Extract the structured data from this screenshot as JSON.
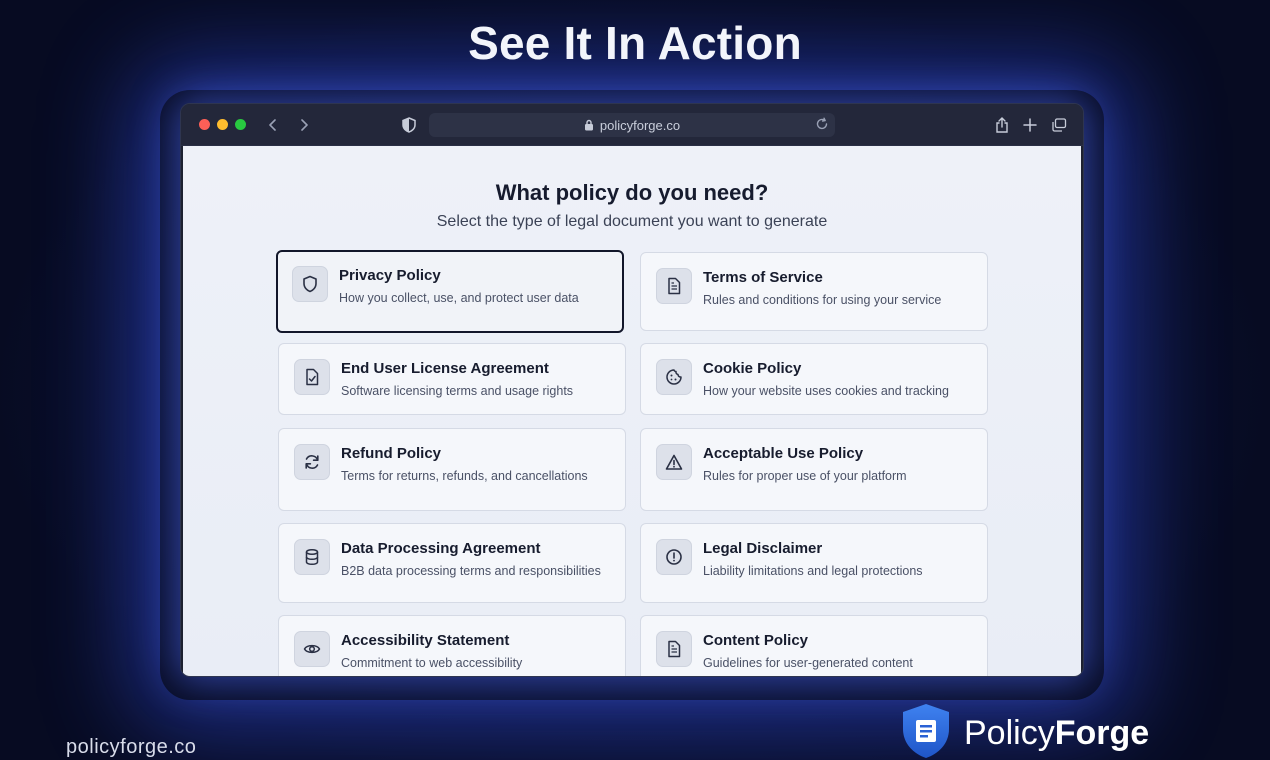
{
  "headline": "See It In Action",
  "browser": {
    "url": "policyforge.co"
  },
  "page": {
    "title": "What policy do you need?",
    "subtitle": "Select the type of legal document you want to generate",
    "cards": [
      {
        "title": "Privacy Policy",
        "desc": "How you collect, use, and protect user data",
        "icon": "shield-icon",
        "selected": true
      },
      {
        "title": "Terms of Service",
        "desc": "Rules and conditions for using your service",
        "icon": "document-icon"
      },
      {
        "title": "End User License Agreement",
        "desc": "Software licensing terms and usage rights",
        "icon": "file-check-icon"
      },
      {
        "title": "Cookie Policy",
        "desc": "How your website uses cookies and tracking",
        "icon": "cookie-icon"
      },
      {
        "title": "Refund Policy",
        "desc": "Terms for returns, refunds, and cancellations",
        "icon": "refresh-icon"
      },
      {
        "title": "Acceptable Use Policy",
        "desc": "Rules for proper use of your platform",
        "icon": "warning-icon"
      },
      {
        "title": "Data Processing Agreement",
        "desc": "B2B data processing terms and responsibilities",
        "icon": "database-icon"
      },
      {
        "title": "Legal Disclaimer",
        "desc": "Liability limitations and legal protections",
        "icon": "alert-circle-icon"
      },
      {
        "title": "Accessibility Statement",
        "desc": "Commitment to web accessibility",
        "icon": "eye-icon"
      },
      {
        "title": "Content Policy",
        "desc": "Guidelines for user-generated content",
        "icon": "document-icon"
      }
    ]
  },
  "footer": {
    "url": "policyforge.co",
    "brand_part1": "Policy",
    "brand_part2": "Forge"
  },
  "colors": {
    "background": "#0a1030",
    "glow": "#3c5aff",
    "card_selected_border": "#12162a",
    "brand_shield": "#2f6fe0"
  }
}
